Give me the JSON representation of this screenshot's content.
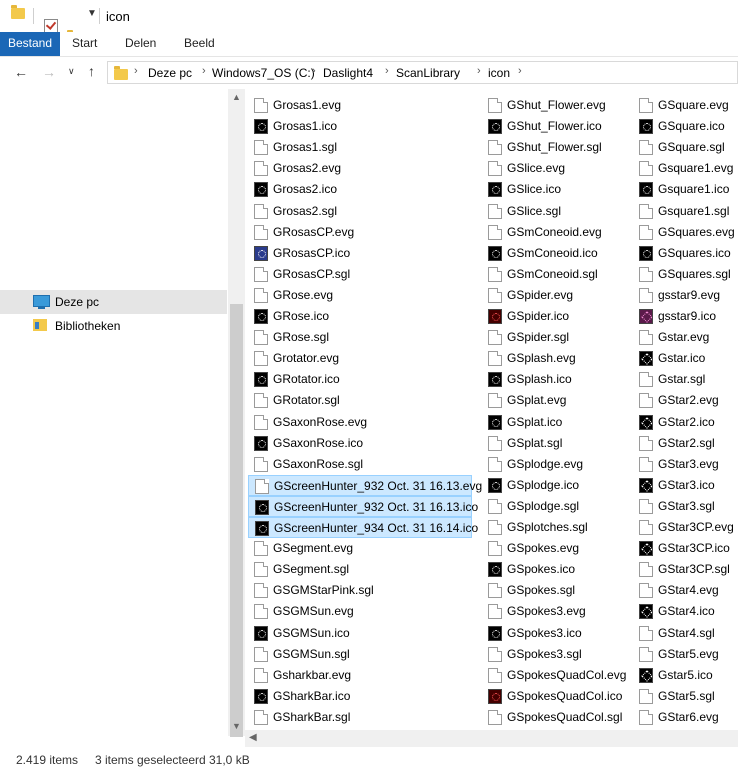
{
  "window": {
    "title": "icon"
  },
  "ribbon": {
    "tabs": [
      "Bestand",
      "Start",
      "Delen",
      "Beeld"
    ]
  },
  "address": {
    "crumbs": [
      "Deze pc",
      "Windows7_OS (C:)",
      "Daslight4",
      "ScanLibrary",
      "icon"
    ]
  },
  "nav": {
    "items": [
      {
        "label": "Deze pc",
        "icon": "computer-icon",
        "selected": true
      },
      {
        "label": "Bibliotheken",
        "icon": "library-icon",
        "selected": false
      }
    ]
  },
  "files": {
    "col1": [
      "Grosas1.evg",
      "Grosas1.ico",
      "Grosas1.sgl",
      "Grosas2.evg",
      "Grosas2.ico",
      "Grosas2.sgl",
      "GRosasCP.evg",
      "GRosasCP.ico",
      "GRosasCP.sgl",
      "GRose.evg",
      "GRose.ico",
      "GRose.sgl",
      "Grotator.evg",
      "GRotator.ico",
      "GRotator.sgl",
      "GSaxonRose.evg",
      "GSaxonRose.ico",
      "GSaxonRose.sgl",
      "GScreenHunter_932 Oct. 31 16.13.evg",
      "GScreenHunter_932 Oct. 31 16.13.ico",
      "GScreenHunter_934 Oct. 31 16.14.ico",
      "GSegment.evg",
      "GSegment.sgl",
      "GSGMStarPink.sgl",
      "GSGMSun.evg",
      "GSGMSun.ico",
      "GSGMSun.sgl",
      "Gsharkbar.evg",
      "GSharkBar.ico",
      "GSharkBar.sgl"
    ],
    "col2": [
      "GShut_Flower.evg",
      "GShut_Flower.ico",
      "GShut_Flower.sgl",
      "GSlice.evg",
      "GSlice.ico",
      "GSlice.sgl",
      "GSmConeoid.evg",
      "GSmConeoid.ico",
      "GSmConeoid.sgl",
      "GSpider.evg",
      "GSpider.ico",
      "GSpider.sgl",
      "GSplash.evg",
      "GSplash.ico",
      "GSplat.evg",
      "GSplat.ico",
      "GSplat.sgl",
      "GSplodge.evg",
      "GSplodge.ico",
      "GSplodge.sgl",
      "GSplotches.sgl",
      "GSpokes.evg",
      "GSpokes.ico",
      "GSpokes.sgl",
      "GSpokes3.evg",
      "GSpokes3.ico",
      "GSpokes3.sgl",
      "GSpokesQuadCol.evg",
      "GSpokesQuadCol.ico",
      "GSpokesQuadCol.sgl"
    ],
    "col3": [
      "GSquare.evg",
      "GSquare.ico",
      "GSquare.sgl",
      "Gsquare1.evg",
      "Gsquare1.ico",
      "Gsquare1.sgl",
      "GSquares.evg",
      "GSquares.ico",
      "GSquares.sgl",
      "gsstar9.evg",
      "gsstar9.ico",
      "Gstar.evg",
      "Gstar.ico",
      "Gstar.sgl",
      "GStar2.evg",
      "GStar2.ico",
      "GStar2.sgl",
      "GStar3.evg",
      "GStar3.ico",
      "GStar3.sgl",
      "GStar3CP.evg",
      "GStar3CP.ico",
      "GStar3CP.sgl",
      "GStar4.evg",
      "GStar4.ico",
      "GStar4.sgl",
      "GStar5.evg",
      "Gstar5.ico",
      "GStar5.sgl",
      "GStar6.evg"
    ],
    "selected": [
      "GScreenHunter_932 Oct. 31 16.13.evg",
      "GScreenHunter_932 Oct. 31 16.13.ico",
      "GScreenHunter_934 Oct. 31 16.14.ico"
    ]
  },
  "status": {
    "count": "2.419 items",
    "selection": "3 items geselecteerd",
    "size": "31,0 kB"
  }
}
